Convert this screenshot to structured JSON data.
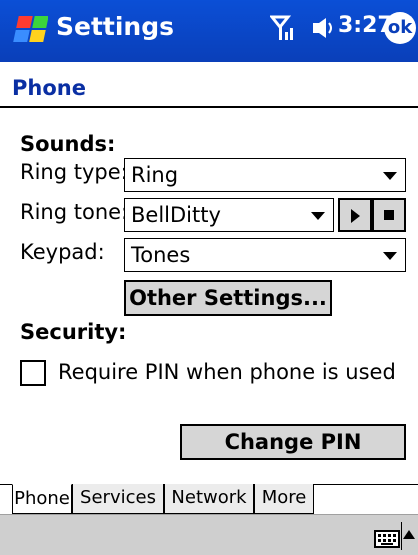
{
  "titlebar": {
    "app_title": "Settings",
    "clock": "3:27",
    "ok_label": "ok",
    "signal_icon": "signal-icon",
    "volume_icon": "volume-icon",
    "start_icon": "windows-flag-icon"
  },
  "page": {
    "title": "Phone"
  },
  "sounds": {
    "heading": "Sounds:",
    "ring_type_label": "Ring type:",
    "ring_type_value": "Ring",
    "ring_tone_label": "Ring tone:",
    "ring_tone_value": "BellDitty",
    "keypad_label": "Keypad:",
    "keypad_value": "Tones",
    "other_settings_label": "Other Settings..."
  },
  "security": {
    "heading": "Security:",
    "require_pin_label": "Require PIN when phone is used",
    "require_pin_checked": false,
    "change_pin_label": "Change PIN"
  },
  "tabs": [
    {
      "label": "Phone",
      "active": true
    },
    {
      "label": "Services",
      "active": false
    },
    {
      "label": "Network",
      "active": false
    },
    {
      "label": "More",
      "active": false
    }
  ],
  "bottom": {
    "keyboard_icon": "keyboard-icon"
  },
  "colors": {
    "titlebar": "#0a3fb9",
    "page_title": "#0a2fa3",
    "button_face": "#d6d6d6"
  }
}
